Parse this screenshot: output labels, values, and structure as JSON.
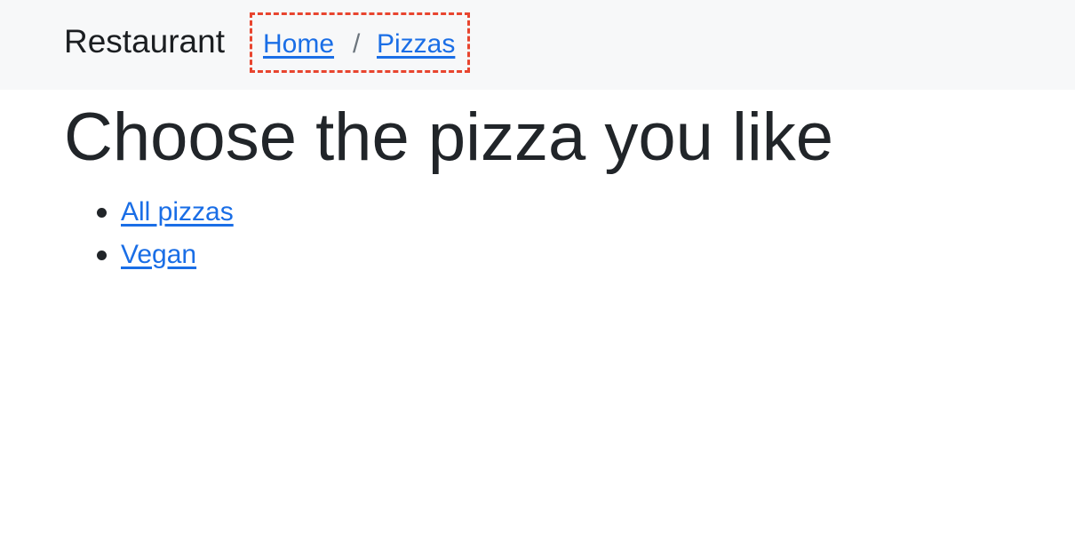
{
  "navbar": {
    "brand": "Restaurant",
    "breadcrumb": {
      "items": [
        "Home",
        "Pizzas"
      ],
      "separator": "/",
      "highlight_color": "#e8452f"
    }
  },
  "main": {
    "title": "Choose the pizza you like",
    "links": [
      "All pizzas",
      "Vegan"
    ]
  },
  "colors": {
    "link": "#1a6ee6",
    "navbar_bg": "#f7f8f9",
    "text": "#212529"
  }
}
